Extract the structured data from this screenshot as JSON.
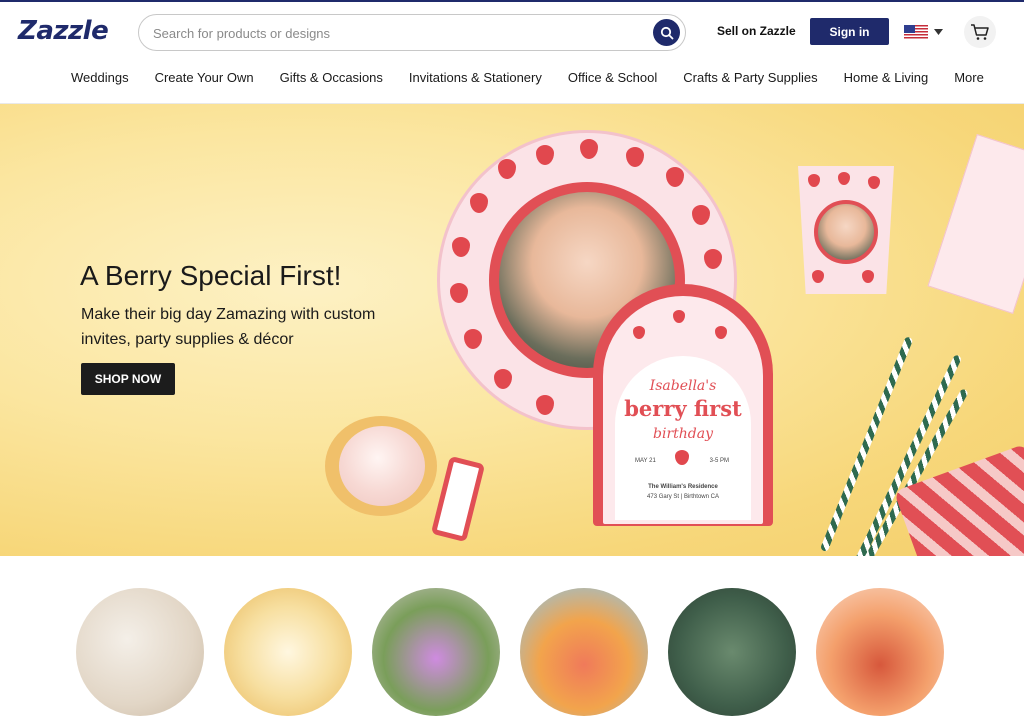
{
  "header": {
    "logo_text": "Zazzle",
    "search_placeholder": "Search for products or designs",
    "sell_label": "Sell on Zazzle",
    "signin_label": "Sign in",
    "brand_color": "#1f2a6b"
  },
  "nav": {
    "items": [
      {
        "label": "Weddings"
      },
      {
        "label": "Create Your Own"
      },
      {
        "label": "Gifts & Occasions"
      },
      {
        "label": "Invitations & Stationery"
      },
      {
        "label": "Office & School"
      },
      {
        "label": "Crafts & Party Supplies"
      },
      {
        "label": "Home & Living"
      },
      {
        "label": "More"
      }
    ]
  },
  "hero": {
    "title": "A Berry Special First!",
    "subtitle": "Make their big day Zamazing with custom invites, party supplies & décor",
    "cta_label": "SHOP NOW",
    "invite": {
      "name": "Isabella's",
      "headline": "berry first",
      "occasion": "birthday",
      "date": "MAY 21",
      "time": "3-5 PM",
      "venue": "The William's Residence",
      "address": "473 Gary St | Birthtown CA"
    }
  },
  "categories": [
    {
      "icon": "wedding-category-icon"
    },
    {
      "icon": "bridal-shower-category-icon"
    },
    {
      "icon": "floral-category-icon"
    },
    {
      "icon": "party-category-icon"
    },
    {
      "icon": "photo-wall-category-icon"
    },
    {
      "icon": "graduation-category-icon"
    }
  ]
}
